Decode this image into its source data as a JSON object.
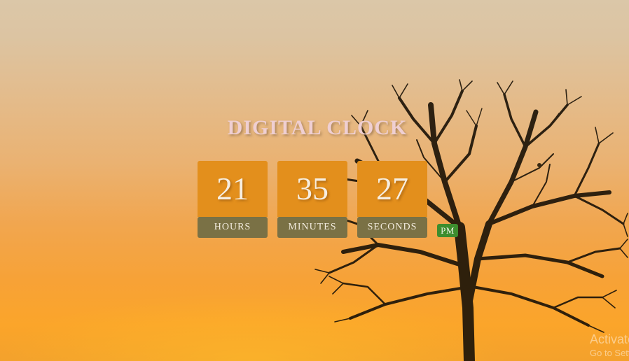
{
  "page": {
    "title": "DIGITAL CLOCK"
  },
  "clock": {
    "hours": "21",
    "minutes": "35",
    "seconds": "27",
    "hours_label": "HOURS",
    "minutes_label": "MINUTES",
    "seconds_label": "SECONDS",
    "period": "PM"
  },
  "watermark": {
    "title": "Activate Windows",
    "subtitle": "Go to Settings to activate Windows."
  },
  "colors": {
    "digit_box": "#e38f1c",
    "label_box": "#7a7145",
    "period_badge": "#3d8d2e",
    "title_text": "#efcfd2"
  },
  "icons": {
    "background": "sunset-tree-illustration"
  }
}
